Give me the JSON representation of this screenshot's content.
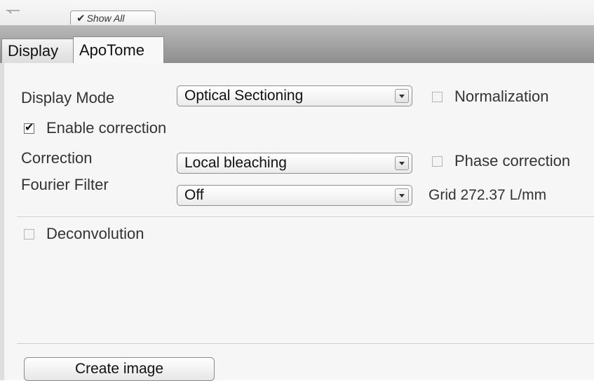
{
  "toolbar": {
    "show_all_label": "Show All",
    "show_all_checked": true
  },
  "tabs": [
    {
      "label": "Display",
      "active": false
    },
    {
      "label": "ApoTome",
      "active": true
    }
  ],
  "apotome": {
    "display_mode": {
      "label": "Display Mode",
      "value": "Optical Sectioning"
    },
    "normalization": {
      "label": "Normalization",
      "checked": false
    },
    "enable_correction": {
      "label": "Enable correction",
      "checked": true
    },
    "correction": {
      "label": "Correction",
      "value": "Local bleaching"
    },
    "phase_correction": {
      "label": "Phase correction",
      "checked": false
    },
    "fourier_filter": {
      "label": "Fourier Filter",
      "value": "Off"
    },
    "grid_readout": "Grid 272.37 L/mm",
    "deconvolution": {
      "label": "Deconvolution",
      "checked": false
    },
    "create_image_label": "Create image"
  }
}
